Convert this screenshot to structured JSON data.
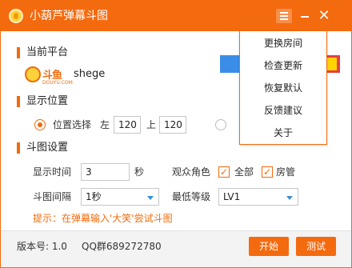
{
  "app": {
    "title": "小葫芦弹幕斗图"
  },
  "platform_section": {
    "title": "当前平台",
    "logo_text": "斗鱼",
    "logo_sub": "DOUYU.COM",
    "username": "shege"
  },
  "position_section": {
    "title": "显示位置",
    "radio_label": "位置选择",
    "left_label": "左",
    "left_value": "120",
    "top_label": "上",
    "top_value": "120"
  },
  "doutu_section": {
    "title": "斗图设置",
    "display_time_label": "显示时间",
    "display_time_value": "3",
    "seconds_unit": "秒",
    "audience_role_label": "观众角色",
    "role_all_label": "全部",
    "role_admin_label": "房管",
    "interval_label": "斗图间隔",
    "interval_value": "1秒",
    "min_level_label": "最低等级",
    "min_level_value": "LV1",
    "hint": "提示：在弹幕输入'大笑'尝试斗图"
  },
  "footer": {
    "version_label": "版本号: 1.0",
    "qq_group": "QQ群689272780",
    "start_button": "开始",
    "test_button": "测试"
  },
  "menu": {
    "items": [
      "更换房间",
      "检查更新",
      "恢复默认",
      "反馈建议",
      "关于"
    ]
  },
  "colors": {
    "accent": "#f46a0f"
  }
}
